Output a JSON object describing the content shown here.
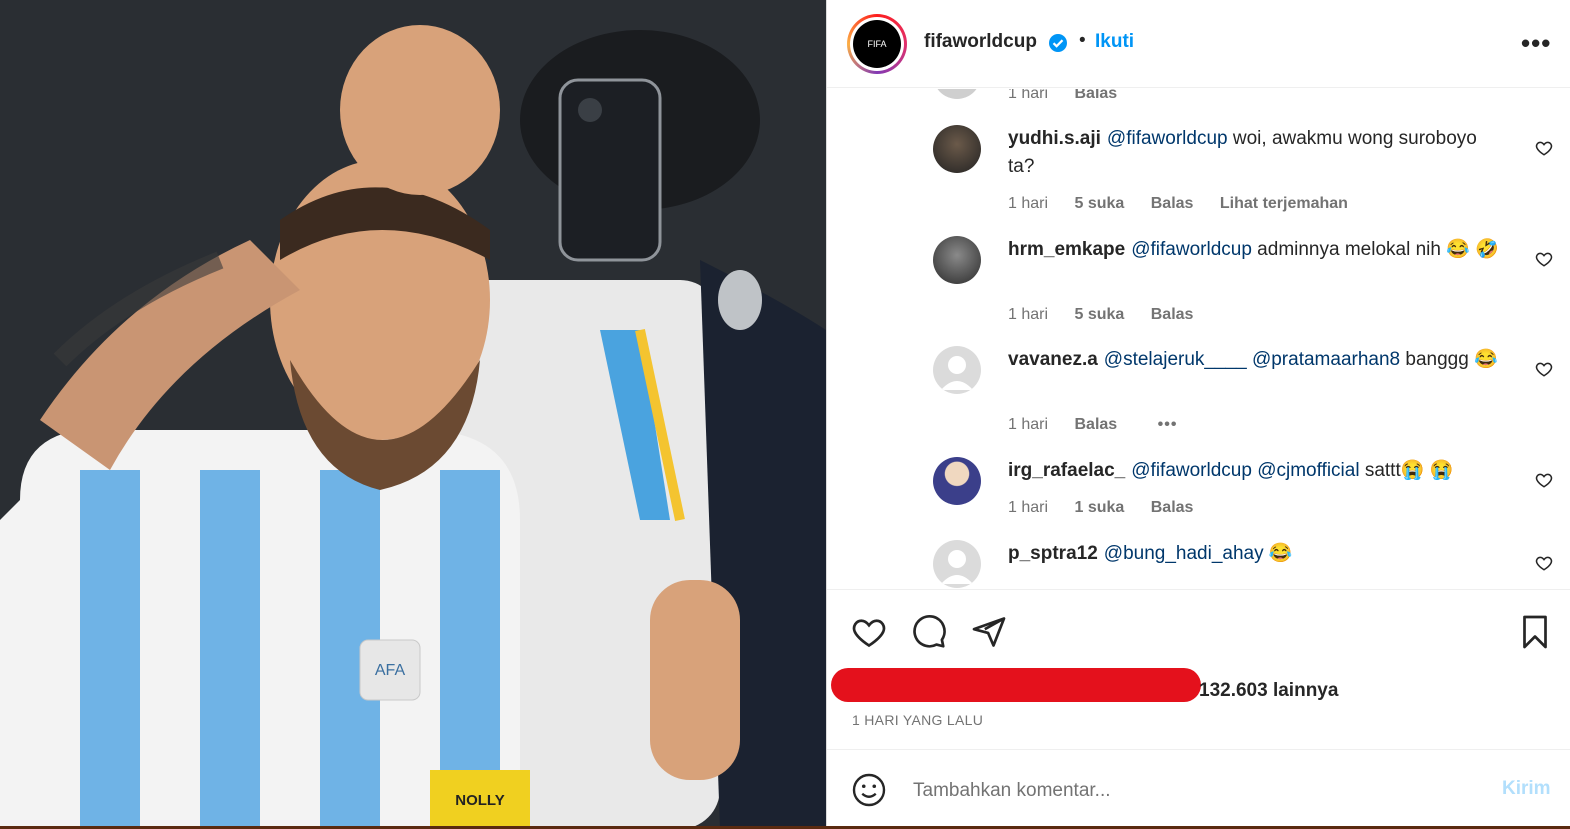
{
  "post": {
    "image_alt": "Player in light blue and white striped jersey waving, smiling",
    "jersey_badge": "AFA",
    "armband": "NOLLY"
  },
  "header": {
    "username": "fifaworldcup",
    "separator": "•",
    "follow_label": "Ikuti",
    "more_label": "•••",
    "avatar_text": "FIFA"
  },
  "comments": [
    {
      "user": "",
      "parts": [],
      "time": "1 hari",
      "likes": "",
      "reply": "Balas",
      "translate": ""
    },
    {
      "user": "yudhi.s.aji",
      "parts": [
        {
          "t": "@fifaworldcup",
          "m": true
        },
        {
          "t": " woi, awakmu wong suroboyo ta?",
          "m": false
        }
      ],
      "time": "1 hari",
      "likes": "5 suka",
      "reply": "Balas",
      "translate": "Lihat terjemahan"
    },
    {
      "user": "hrm_emkape",
      "parts": [
        {
          "t": "@fifaworldcup",
          "m": true
        },
        {
          "t": " adminnya melokal nih 😂 🤣",
          "m": false
        }
      ],
      "time": "1 hari",
      "likes": "5 suka",
      "reply": "Balas",
      "translate": ""
    },
    {
      "user": "vavanez.a",
      "parts": [
        {
          "t": "@stelajeruk____",
          "m": true
        },
        {
          "t": " ",
          "m": false
        },
        {
          "t": "@pratamaarhan8",
          "m": true
        },
        {
          "t": " banggg 😂",
          "m": false
        }
      ],
      "time": "1 hari",
      "likes": "",
      "reply": "Balas",
      "translate": "•••"
    },
    {
      "user": "irg_rafaelac_",
      "parts": [
        {
          "t": "@fifaworldcup",
          "m": true
        },
        {
          "t": " ",
          "m": false
        },
        {
          "t": "@cjmofficial",
          "m": true
        },
        {
          "t": " sattt😭 😭",
          "m": false
        }
      ],
      "time": "1 hari",
      "likes": "1 suka",
      "reply": "Balas",
      "translate": ""
    },
    {
      "user": "p_sptra12",
      "parts": [
        {
          "t": "@bung_hadi_ahay",
          "m": true
        },
        {
          "t": " 😂",
          "m": false
        }
      ],
      "time": "",
      "likes": "",
      "reply": "",
      "translate": ""
    }
  ],
  "likes_text": "132.603 lainnya",
  "time_ago": "1 HARI YANG LALU",
  "composer": {
    "placeholder": "Tambahkan komentar...",
    "send_label": "Kirim"
  },
  "colors": {
    "accent": "#0095f6",
    "mention": "#00376b",
    "redaction": "#e4111c"
  }
}
